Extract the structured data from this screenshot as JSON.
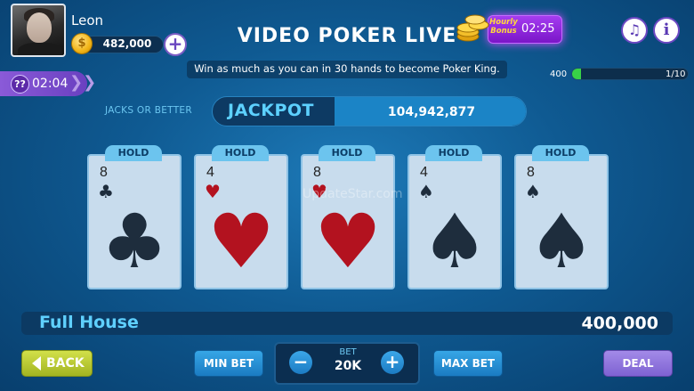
{
  "player": {
    "name": "Leon",
    "coins": "482,000",
    "coin_icon": "dollar-coin-icon",
    "add_coins_label": "+"
  },
  "header": {
    "title": "VIDEO POKER LIVE",
    "subtitle": "Win as much as you can in 30 hands to become Poker King."
  },
  "bonus": {
    "label": "Hourly Bonus",
    "timer": "02:25"
  },
  "toolbar": {
    "music_icon": "music-off-icon",
    "info_icon": "info-icon",
    "music_glyph": "♫",
    "info_glyph": "i"
  },
  "progress": {
    "score": "400",
    "hands": "1/10",
    "fraction": 0.08
  },
  "timer": {
    "icon_text": "??",
    "value": "02:04",
    "chevron": "❯❯"
  },
  "jackpot": {
    "game_type": "JACKS OR BETTER",
    "label": "JACKPOT",
    "value": "104,942,877"
  },
  "cards": [
    {
      "hold": "HOLD",
      "rank": "8",
      "suit": "♣",
      "color": "black"
    },
    {
      "hold": "HOLD",
      "rank": "4",
      "suit": "♥",
      "color": "red"
    },
    {
      "hold": "HOLD",
      "rank": "8",
      "suit": "♥",
      "color": "red"
    },
    {
      "hold": "HOLD",
      "rank": "4",
      "suit": "♠",
      "color": "black"
    },
    {
      "hold": "HOLD",
      "rank": "8",
      "suit": "♠",
      "color": "black"
    }
  ],
  "watermark": "UpdateStar.com",
  "result": {
    "hand": "Full House",
    "payout": "400,000"
  },
  "controls": {
    "back": "BACK",
    "min_bet": "MIN BET",
    "bet_label": "BET",
    "bet_value": "20K",
    "minus": "−",
    "plus": "+",
    "max_bet": "MAX BET",
    "deal": "DEAL"
  },
  "colors": {
    "accent": "#5dd1ff",
    "deal": "#8c72dc",
    "back": "#b8c92f",
    "progress": "#38d247"
  }
}
